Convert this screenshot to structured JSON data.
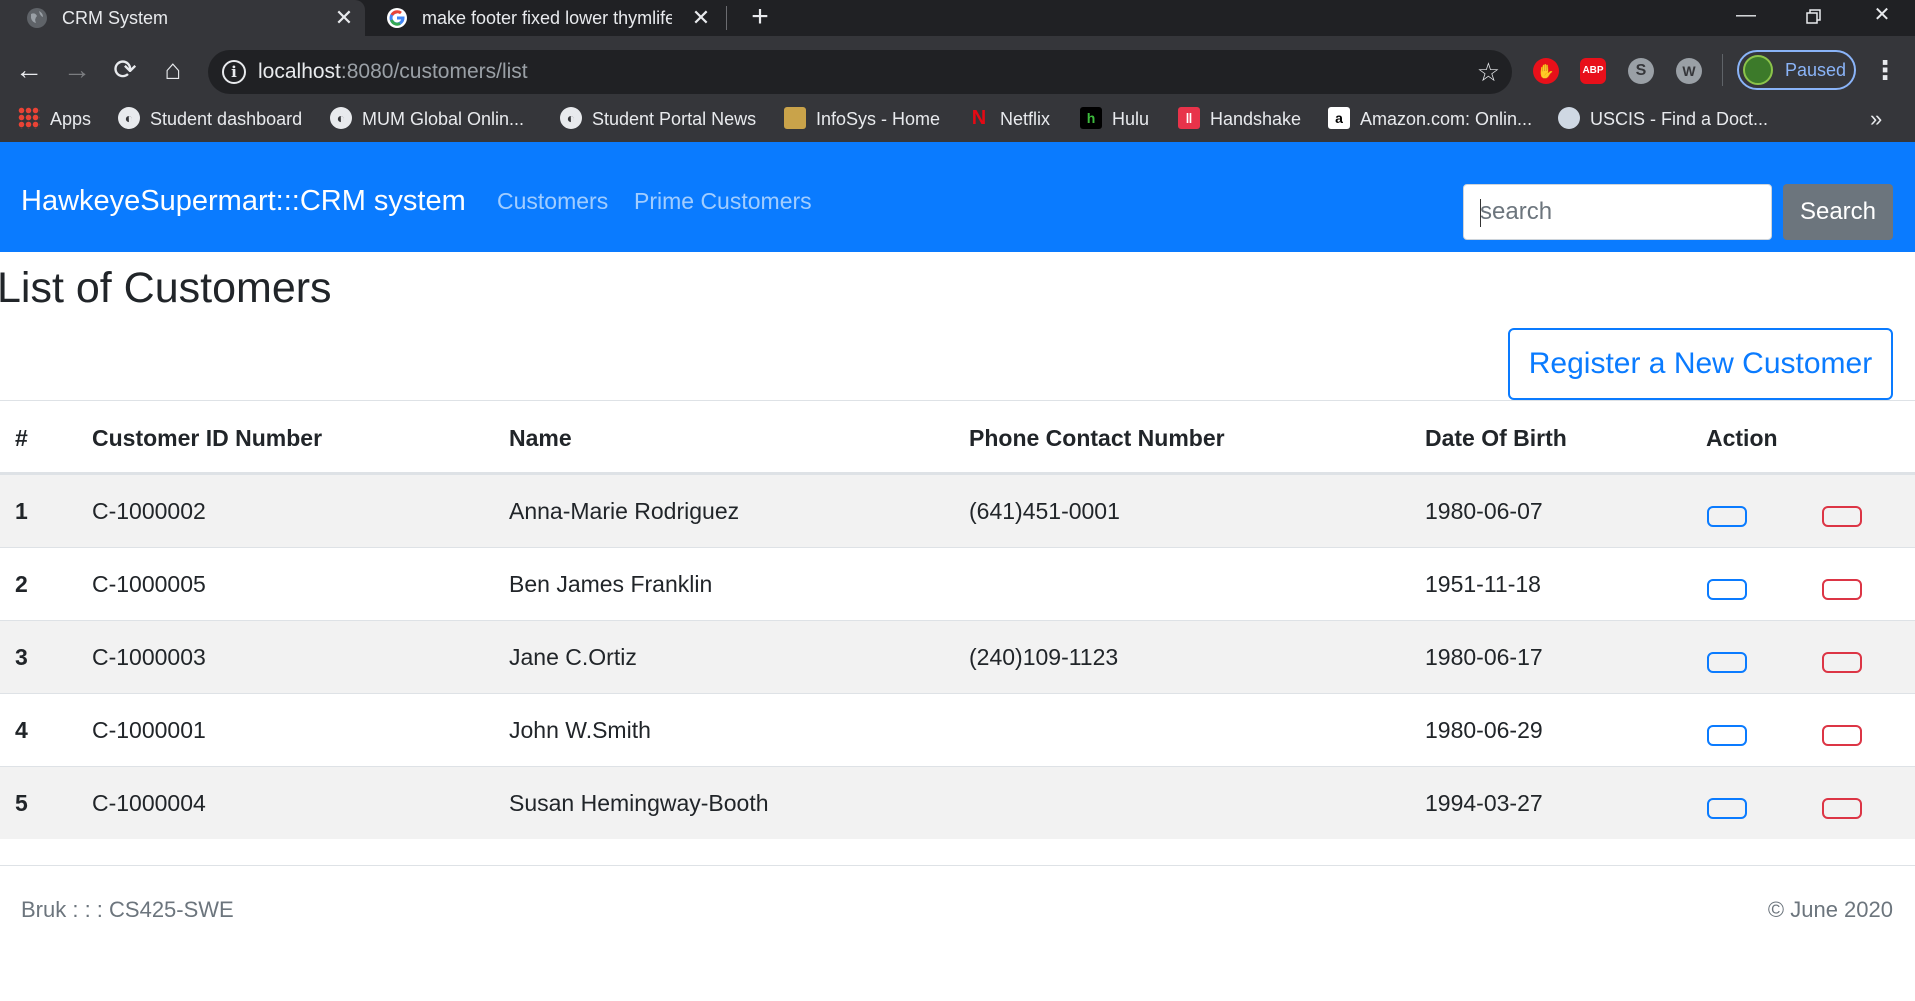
{
  "browser": {
    "tabs": [
      {
        "title": "CRM System",
        "favicon": "globe-icon"
      },
      {
        "title": "make footer fixed lower thymlife",
        "favicon": "google-icon"
      }
    ],
    "url_host": "localhost",
    "url_rest": ":8080/customers/list",
    "profile_label": "Paused",
    "extensions": [
      {
        "name": "stop-hand-icon",
        "glyph": "✋",
        "color": "#e8101a"
      },
      {
        "name": "adblock-plus-icon",
        "glyph": "ABP",
        "color": "#e8101a"
      },
      {
        "name": "skype-icon",
        "glyph": "S",
        "color": "#9aa0a6"
      },
      {
        "name": "w-extension-icon",
        "glyph": "W",
        "color": "#9aa0a6"
      }
    ],
    "bookmarks": [
      {
        "label": "Apps",
        "icon": "apps-grid-icon"
      },
      {
        "label": "Student dashboard",
        "icon": "globe-icon"
      },
      {
        "label": "MUM Global Onlin...",
        "icon": "globe-icon"
      },
      {
        "label": "Student Portal News",
        "icon": "globe-icon"
      },
      {
        "label": "InfoSys - Home",
        "icon": "infosys-icon"
      },
      {
        "label": "Netflix",
        "icon": "netflix-icon"
      },
      {
        "label": "Hulu",
        "icon": "hulu-icon"
      },
      {
        "label": "Handshake",
        "icon": "handshake-icon"
      },
      {
        "label": "Amazon.com: Onlin...",
        "icon": "amazon-icon"
      },
      {
        "label": "USCIS - Find a Doct...",
        "icon": "uscis-icon"
      }
    ],
    "bookmarks_overflow": "»"
  },
  "navbar": {
    "brand": "HawkeyeSupermart:::CRM system",
    "links": [
      "Customers",
      "Prime Customers"
    ],
    "search_placeholder": "search",
    "search_button": "Search"
  },
  "page": {
    "title": "List of Customers",
    "register_button": "Register a New Customer"
  },
  "table": {
    "headers": [
      "#",
      "Customer ID Number",
      "Name",
      "Phone Contact Number",
      "Date Of Birth",
      "Action"
    ],
    "rows": [
      {
        "num": "1",
        "id": "C-1000002",
        "name": "Anna-Marie Rodriguez",
        "phone": "(641)451-0001",
        "dob": "1980-06-07"
      },
      {
        "num": "2",
        "id": "C-1000005",
        "name": "Ben James Franklin",
        "phone": "",
        "dob": "1951-11-18"
      },
      {
        "num": "3",
        "id": "C-1000003",
        "name": "Jane C.Ortiz",
        "phone": "(240)109-1123",
        "dob": "1980-06-17"
      },
      {
        "num": "4",
        "id": "C-1000001",
        "name": "John W.Smith",
        "phone": "",
        "dob": "1980-06-29"
      },
      {
        "num": "5",
        "id": "C-1000004",
        "name": "Susan Hemingway-Booth",
        "phone": "",
        "dob": "1994-03-27"
      }
    ]
  },
  "footer": {
    "left": "Bruk : : : CS425-SWE",
    "right": "© June 2020"
  },
  "colors": {
    "primary": "#0a7bff",
    "danger": "#dc3545",
    "secondary": "#6c757d"
  }
}
